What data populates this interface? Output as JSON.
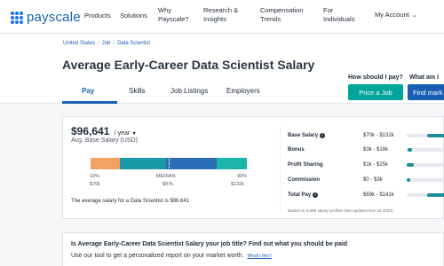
{
  "brand": {
    "logo_text": "payscale",
    "logo_color": "#1a5fb4"
  },
  "nav": {
    "items": [
      {
        "label": "Products"
      },
      {
        "label": "Solutions"
      },
      {
        "label_line1": "Why",
        "label_line2": "Payscale?"
      },
      {
        "label_line1": "Research &",
        "label_line2": "Insights"
      },
      {
        "label_line1": "Compensation",
        "label_line2": "Trends"
      },
      {
        "label_line1": "For",
        "label_line2": "Individuals"
      }
    ],
    "account_label": "My Account",
    "account_icon": "chevron-down-icon"
  },
  "breadcrumb": [
    "United States",
    "Job",
    "Data Scientist"
  ],
  "page_title": "Average Early-Career Data Scientist Salary",
  "tabs": [
    "Pay",
    "Skills",
    "Job Listings",
    "Employers"
  ],
  "active_tab": "Pay",
  "cta": {
    "price_question": "How should I pay?",
    "price_button": "Price a Job",
    "market_question": "What am I",
    "market_button": "Find mark"
  },
  "salary": {
    "amount": "$96,641",
    "unit": "/ year",
    "caret": "▼",
    "subtitle": "Avg. Base Salary (USD)",
    "percentiles": {
      "p10_label": "10%",
      "p10_value": "$70k",
      "median_label": "MEDIAN",
      "median_value": "$97k",
      "p90_label": "90%",
      "p90_value": "$132k"
    },
    "note": "The average salary for a Data Scientist is $96,641"
  },
  "compensation": [
    {
      "label": "Base Salary",
      "info": true,
      "range": "$70k - $132k",
      "low": 70,
      "high": 132
    },
    {
      "label": "Bonus",
      "info": false,
      "range": "$3k - $18k",
      "low": 3,
      "high": 18
    },
    {
      "label": "Profit Sharing",
      "info": false,
      "range": "$1k - $25k",
      "low": 1,
      "high": 25
    },
    {
      "label": "Commission",
      "info": false,
      "range": "$0 - $3k",
      "low": 0,
      "high": 3
    },
    {
      "label": "Total Pay",
      "info": true,
      "range": "$69k - $141k",
      "low": 69,
      "high": 141
    }
  ],
  "comp_footnote": "Based on 4,696 salary profiles (last updated Nov 16 2022)",
  "promo": {
    "title": "Is Average Early-Career Data Scientist Salary your job title? Find out what you should be paid",
    "subtitle": "Use our tool to get a personalized report on your market worth.",
    "link": "What's this?"
  },
  "colors": {
    "teal": "#00a69a",
    "blue": "#1a5fb4",
    "bar_orange": "#f4a261",
    "bar_teal": "#1a9aa6",
    "bar_blue": "#2a6fb6",
    "bar_mint": "#1cb5ac"
  }
}
